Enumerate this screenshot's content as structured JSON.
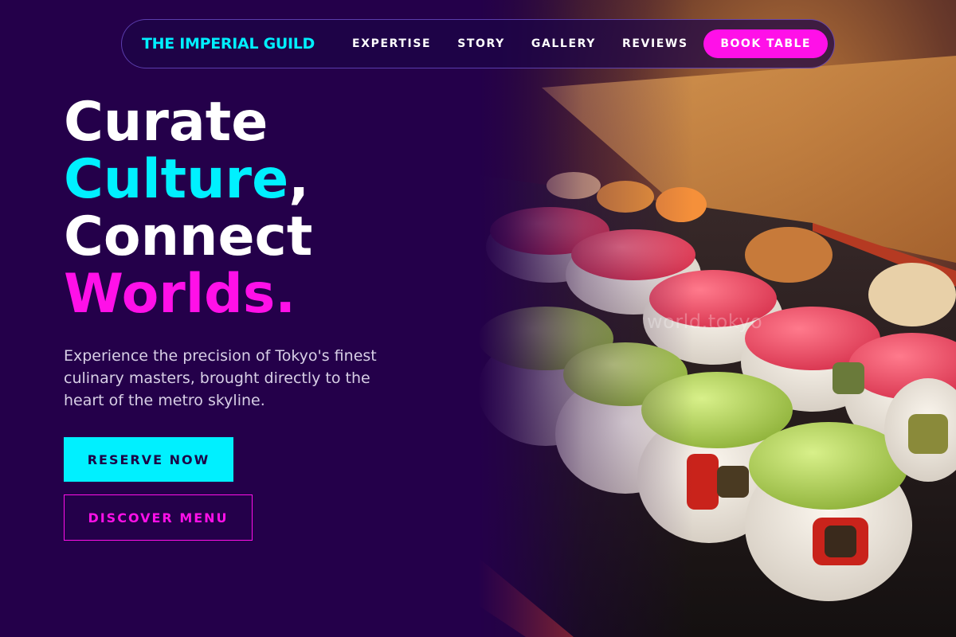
{
  "nav": {
    "brand": "THE IMPERIAL GUILD",
    "links": [
      "EXPERTISE",
      "STORY",
      "GALLERY",
      "REVIEWS"
    ],
    "cta": "BOOK TABLE"
  },
  "hero": {
    "headline": {
      "line1": "Curate",
      "line2_accent": "Culture",
      "line2_rest": ",",
      "line3": "Connect",
      "line4_accent": "Worlds."
    },
    "lede": "Experience the precision of Tokyo's finest culinary masters, brought directly to the heart of the metro skyline.",
    "primary_button": "RESERVE NOW",
    "secondary_button": "DISCOVER MENU",
    "image_watermark": "world.tokyo"
  },
  "colors": {
    "background": "#24004a",
    "accent_cyan": "#00f0ff",
    "accent_magenta": "#ff10e8"
  }
}
